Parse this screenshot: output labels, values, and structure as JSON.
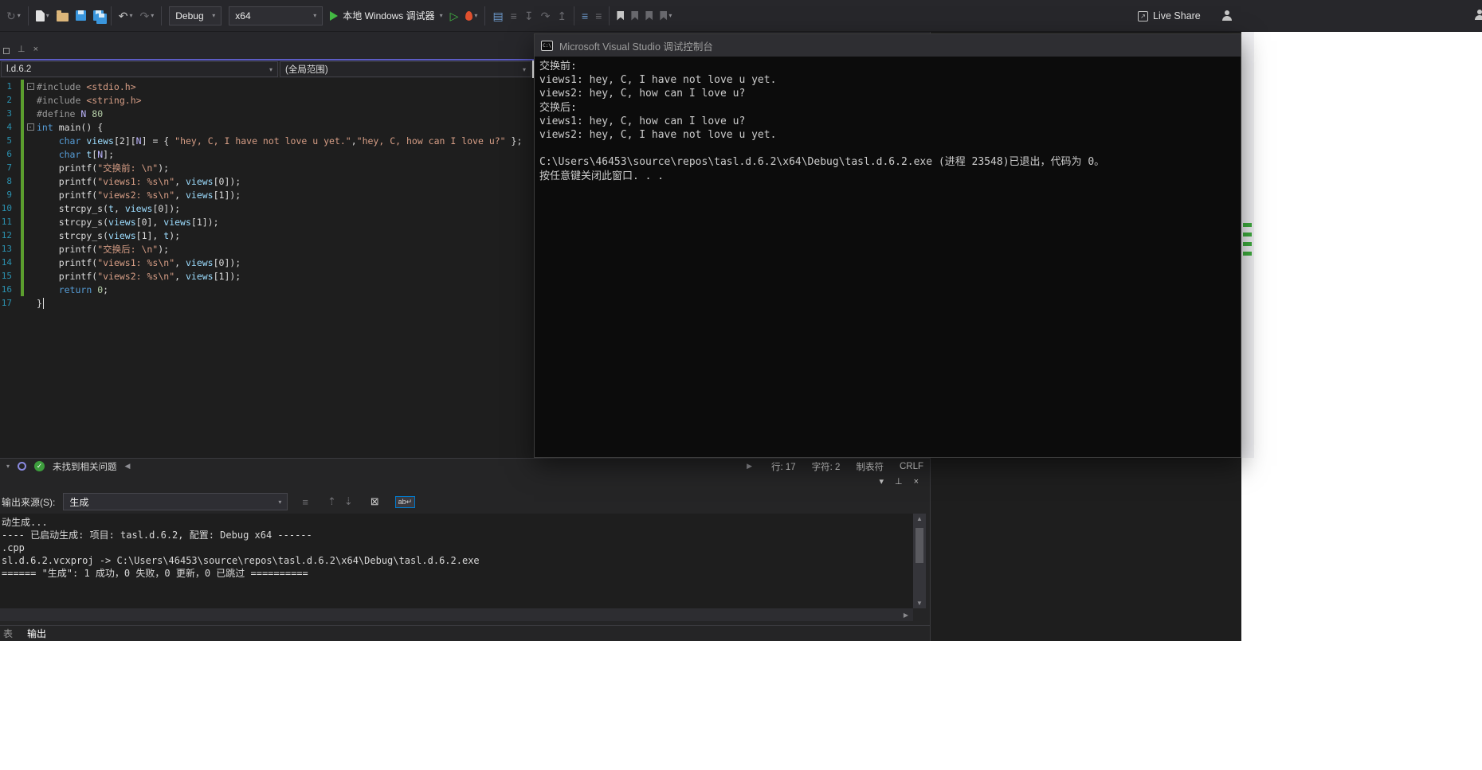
{
  "colors": {
    "accent": "#007acc",
    "run_green": "#43b943",
    "change_green": "#5b9e2e",
    "line_number_blue": "#2b91af",
    "string_color": "#d69d85",
    "keyword_color": "#569cd6"
  },
  "icons": {
    "caret_down": "▾",
    "chevron_down": "▾",
    "close": "×",
    "pin": "⊥",
    "circle_arrow": "↻",
    "undo": "↶",
    "redo": "↷",
    "play_outline": "▷",
    "arrow_left": "◀",
    "arrow_right": "▶",
    "arrow_up": "▲",
    "arrow_down": "▼",
    "check": "✓",
    "diagnostics": "▤",
    "list": "≡",
    "step_into": "↧",
    "step_over": "↷",
    "step_out": "↥",
    "indent_a": "≡",
    "indent_b": "≡",
    "prev_msg": "⇡",
    "next_msg": "⇣",
    "clear_all": "⊠",
    "word_wrap": "ab↵",
    "share_arrow": "↗",
    "console_glyph": "C:\\"
  },
  "toolbar": {
    "debug_config": "Debug",
    "platform": "x64",
    "run_label": "本地 Windows 调试器",
    "live_share_label": "Live Share"
  },
  "editor": {
    "document_dropdown": "l.d.6.2",
    "scope_dropdown": "(全局范围)",
    "lines": [
      {
        "n": 1,
        "fold": "-",
        "segs": [
          [
            "pp",
            "#include "
          ],
          [
            "str",
            "<stdio.h>"
          ]
        ]
      },
      {
        "n": 2,
        "segs": [
          [
            "pp",
            "#include "
          ],
          [
            "str",
            "<string.h>"
          ]
        ]
      },
      {
        "n": 3,
        "segs": [
          [
            "pp",
            "#define "
          ],
          [
            "mac",
            "N"
          ],
          [
            "tx",
            " "
          ],
          [
            "num",
            "80"
          ]
        ]
      },
      {
        "n": 4,
        "fold": "-",
        "segs": [
          [
            "kw",
            "int"
          ],
          [
            "tx",
            " "
          ],
          [
            "fn",
            "main"
          ],
          [
            "tx",
            "() {"
          ]
        ]
      },
      {
        "n": 5,
        "segs": [
          [
            "tx",
            "    "
          ],
          [
            "kw",
            "char"
          ],
          [
            "tx",
            " "
          ],
          [
            "var",
            "views"
          ],
          [
            "tx",
            "[2]["
          ],
          [
            "mac",
            "N"
          ],
          [
            "tx",
            "] = { "
          ],
          [
            "str",
            "\"hey, C, I have not love u yet.\""
          ],
          [
            "tx",
            ","
          ],
          [
            "str",
            "\"hey, C, how can I love u?\""
          ],
          [
            "tx",
            " };"
          ]
        ]
      },
      {
        "n": 6,
        "segs": [
          [
            "tx",
            "    "
          ],
          [
            "kw",
            "char"
          ],
          [
            "tx",
            " "
          ],
          [
            "var",
            "t"
          ],
          [
            "tx",
            "["
          ],
          [
            "mac",
            "N"
          ],
          [
            "tx",
            "];"
          ]
        ]
      },
      {
        "n": 7,
        "segs": [
          [
            "tx",
            "    "
          ],
          [
            "fn",
            "printf"
          ],
          [
            "tx",
            "("
          ],
          [
            "str",
            "\"交换前: \\n\""
          ],
          [
            "tx",
            ");"
          ]
        ]
      },
      {
        "n": 8,
        "segs": [
          [
            "tx",
            "    "
          ],
          [
            "fn",
            "printf"
          ],
          [
            "tx",
            "("
          ],
          [
            "str",
            "\"views1: %s\\n\""
          ],
          [
            "tx",
            ", "
          ],
          [
            "var",
            "views"
          ],
          [
            "tx",
            "[0]);"
          ]
        ]
      },
      {
        "n": 9,
        "segs": [
          [
            "tx",
            "    "
          ],
          [
            "fn",
            "printf"
          ],
          [
            "tx",
            "("
          ],
          [
            "str",
            "\"views2: %s\\n\""
          ],
          [
            "tx",
            ", "
          ],
          [
            "var",
            "views"
          ],
          [
            "tx",
            "[1]);"
          ]
        ]
      },
      {
        "n": 10,
        "segs": [
          [
            "tx",
            "    "
          ],
          [
            "fn",
            "strcpy_s"
          ],
          [
            "tx",
            "("
          ],
          [
            "var",
            "t"
          ],
          [
            "tx",
            ", "
          ],
          [
            "var",
            "views"
          ],
          [
            "tx",
            "[0]);"
          ]
        ]
      },
      {
        "n": 11,
        "segs": [
          [
            "tx",
            "    "
          ],
          [
            "fn",
            "strcpy_s"
          ],
          [
            "tx",
            "("
          ],
          [
            "var",
            "views"
          ],
          [
            "tx",
            "[0], "
          ],
          [
            "var",
            "views"
          ],
          [
            "tx",
            "[1]);"
          ]
        ]
      },
      {
        "n": 12,
        "segs": [
          [
            "tx",
            "    "
          ],
          [
            "fn",
            "strcpy_s"
          ],
          [
            "tx",
            "("
          ],
          [
            "var",
            "views"
          ],
          [
            "tx",
            "[1], "
          ],
          [
            "var",
            "t"
          ],
          [
            "tx",
            ");"
          ]
        ]
      },
      {
        "n": 13,
        "segs": [
          [
            "tx",
            "    "
          ],
          [
            "fn",
            "printf"
          ],
          [
            "tx",
            "("
          ],
          [
            "str",
            "\"交换后: \\n\""
          ],
          [
            "tx",
            ");"
          ]
        ]
      },
      {
        "n": 14,
        "segs": [
          [
            "tx",
            "    "
          ],
          [
            "fn",
            "printf"
          ],
          [
            "tx",
            "("
          ],
          [
            "str",
            "\"views1: %s\\n\""
          ],
          [
            "tx",
            ", "
          ],
          [
            "var",
            "views"
          ],
          [
            "tx",
            "[0]);"
          ]
        ]
      },
      {
        "n": 15,
        "segs": [
          [
            "tx",
            "    "
          ],
          [
            "fn",
            "printf"
          ],
          [
            "tx",
            "("
          ],
          [
            "str",
            "\"views2: %s\\n\""
          ],
          [
            "tx",
            ", "
          ],
          [
            "var",
            "views"
          ],
          [
            "tx",
            "[1]);"
          ]
        ]
      },
      {
        "n": 16,
        "segs": [
          [
            "tx",
            "    "
          ],
          [
            "kw",
            "return"
          ],
          [
            "tx",
            " "
          ],
          [
            "num",
            "0"
          ],
          [
            "tx",
            ";"
          ]
        ]
      },
      {
        "n": 17,
        "segs": [
          [
            "tx",
            "}"
          ]
        ]
      }
    ]
  },
  "health_bar": {
    "status": "未找到相关问题"
  },
  "status_bar": {
    "line": "行: 17",
    "column": "字符: 2",
    "tabs": "制表符",
    "eol": "CRLF"
  },
  "output_panel": {
    "source_label": "输出来源(S):",
    "source_value": "生成",
    "lines": [
      "动生成...",
      "---- 已启动生成: 项目: tasl.d.6.2, 配置: Debug x64 ------",
      ".cpp",
      "sl.d.6.2.vcxproj -> C:\\Users\\46453\\source\\repos\\tasl.d.6.2\\x64\\Debug\\tasl.d.6.2.exe",
      "====== \"生成\": 1 成功，0 失败，0 更新，0 已跳过 =========="
    ]
  },
  "panel_tabs": {
    "error_list": "表",
    "output": "输出"
  },
  "console_window": {
    "title": "Microsoft Visual Studio 调试控制台",
    "lines": [
      "交换前:",
      "views1: hey, C, I have not love u yet.",
      "views2: hey, C, how can I love u?",
      "交换后:",
      "views1: hey, C, how can I love u?",
      "views2: hey, C, I have not love u yet.",
      "",
      "C:\\Users\\46453\\source\\repos\\tasl.d.6.2\\x64\\Debug\\tasl.d.6.2.exe (进程 23548)已退出，代码为 0。",
      "按任意键关闭此窗口. . ."
    ]
  }
}
